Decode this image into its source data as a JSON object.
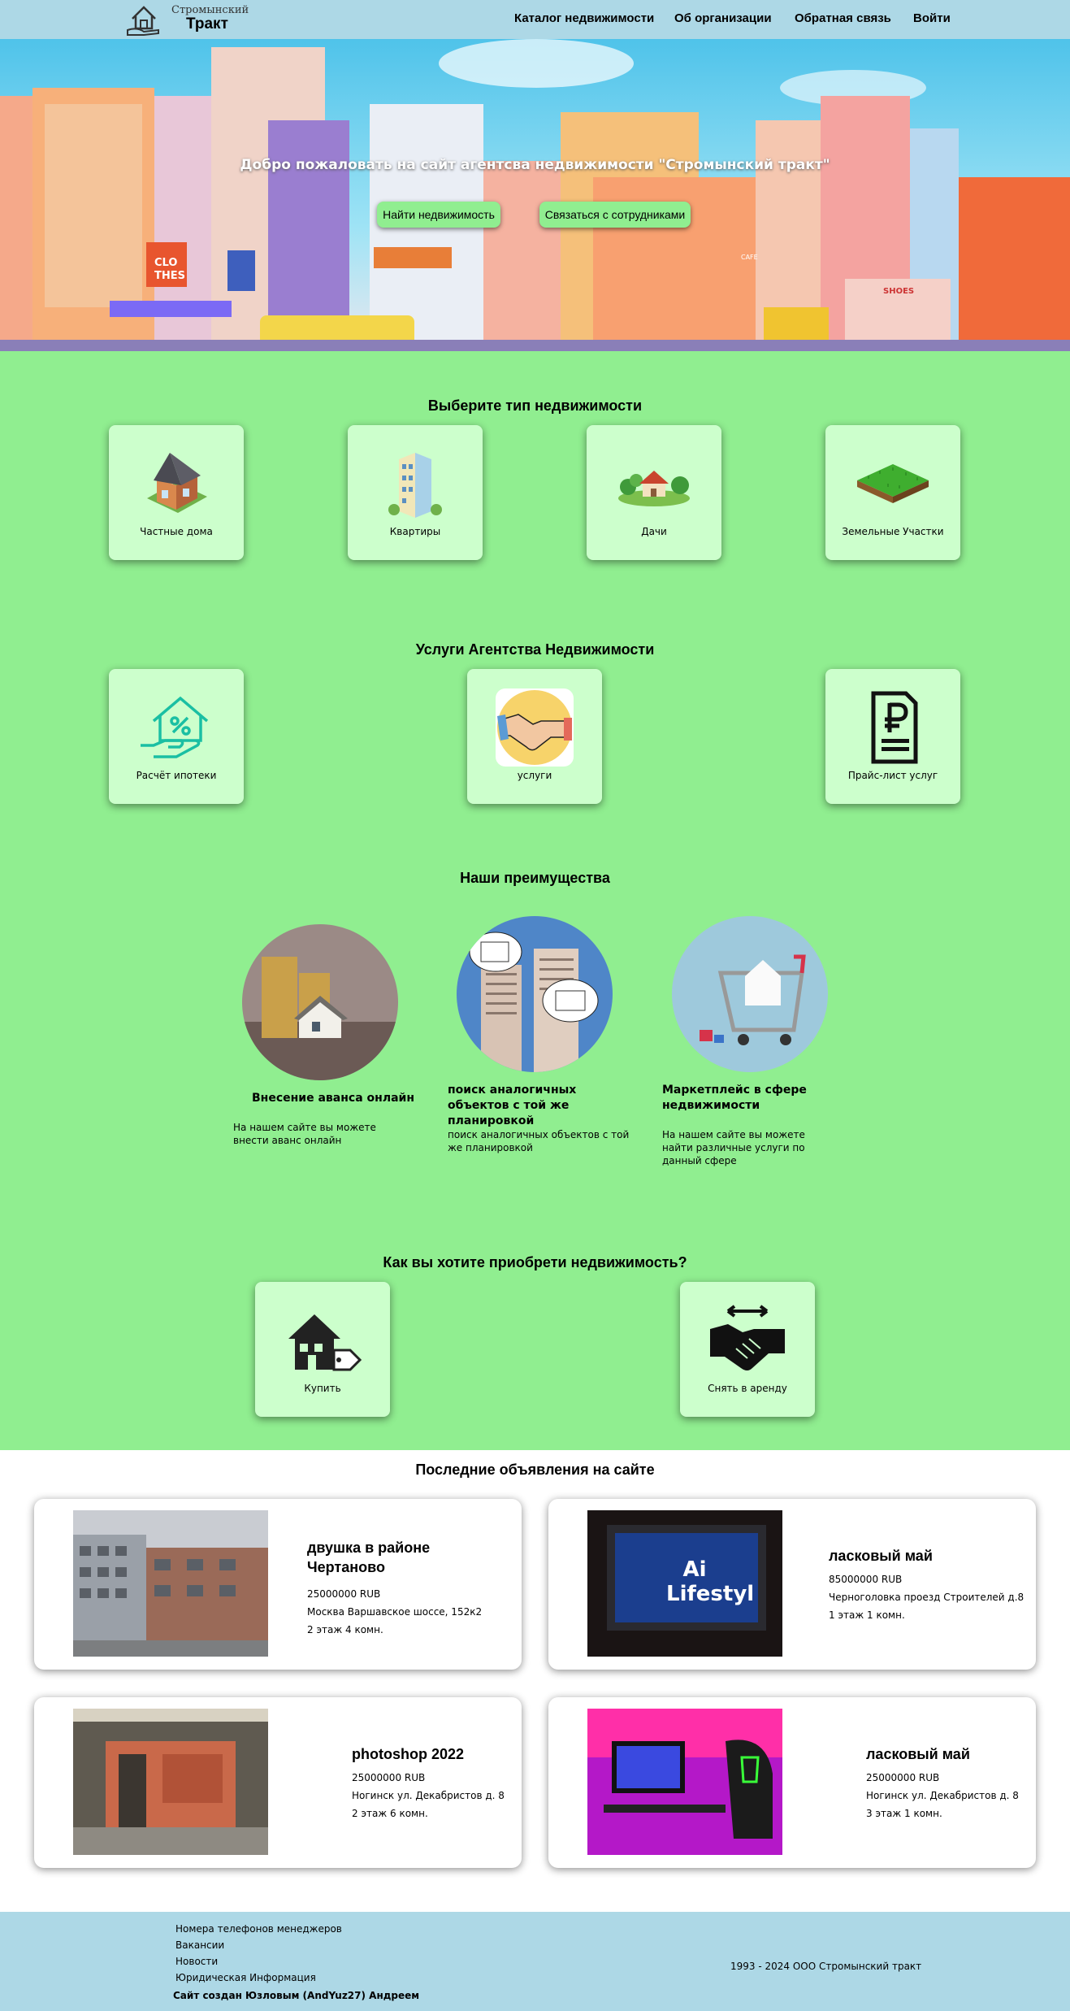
{
  "header": {
    "logo_line1": "Стромынский",
    "logo_line2": "Тракт",
    "nav": [
      "Каталог недвижимости",
      "Об организации",
      "Обратная связь",
      "Войти"
    ]
  },
  "hero": {
    "title": "Добро пожаловать на сайт агентсва недвижимости \"Стромынский тракт\"",
    "btn_find": "Найти недвижимость",
    "btn_contact": "Связаться с сотрудниками",
    "signs": [
      "CLO THES",
      "SHOES",
      "CAFE"
    ]
  },
  "types": {
    "title": "Выберите тип недвижимости",
    "items": [
      {
        "label": "Частные дома",
        "icon": "house-icon"
      },
      {
        "label": "Квартиры",
        "icon": "apartment-building-icon"
      },
      {
        "label": "Дачи",
        "icon": "country-house-icon"
      },
      {
        "label": "Земельные Участки",
        "icon": "land-plot-icon"
      }
    ]
  },
  "services": {
    "title": "Услуги Агентства Недвижимости",
    "items": [
      {
        "label": "Расчёт ипотеки",
        "icon": "mortgage-icon"
      },
      {
        "label": "услуги",
        "icon": "handshake-icon"
      },
      {
        "label": "Прайс-лист услуг",
        "icon": "price-list-icon"
      }
    ]
  },
  "advantages": {
    "title": "Наши преимущества",
    "items": [
      {
        "heading": "Внесение аванса онлайн",
        "text": "На нашем сайте вы можете внести аванс онлайн"
      },
      {
        "heading": "поиск аналогичных объектов с той же планировкой",
        "text": "поиск аналогичных объектов с той же планировкой"
      },
      {
        "heading": "Маркетплейс в сфере недвижимости",
        "text": "На нашем сайте вы можете найти различные услуги по данный сфере"
      }
    ]
  },
  "acquire": {
    "title": "Как вы хотите приобрети недвижимость?",
    "items": [
      {
        "label": "Купить",
        "icon": "house-price-tag-icon"
      },
      {
        "label": "Снять в аренду",
        "icon": "handshake-arrows-icon"
      }
    ]
  },
  "latest": {
    "title": "Последние объявления на сайте",
    "listings": [
      {
        "title": "двушка в районе Чертаново",
        "price": "25000000 RUB",
        "address": "Москва Варшавское шоссе, 152к2",
        "details": "2 этаж 4 комн."
      },
      {
        "title": "ласковый май",
        "price": "85000000 RUB",
        "address": "Черноголовка проезд Строителей д.8",
        "details": "1 этаж 1 комн.",
        "photo_text": "Ai Lifestyl"
      },
      {
        "title": "photoshop 2022",
        "price": "25000000 RUB",
        "address": "Ногинск ул. Декабристов д. 8",
        "details": "2 этаж 6 комн."
      },
      {
        "title": "ласковый май",
        "price": "25000000 RUB",
        "address": "Ногинск ул. Декабристов д. 8",
        "details": "3 этаж 1 комн."
      }
    ]
  },
  "footer": {
    "links": [
      "Номера телефонов менеджеров",
      "Вакансии",
      "Новости",
      "Юридическая Информация"
    ],
    "author": "Сайт создан Юзловым (AndYuz27) Андреем",
    "copyright": "1993 - 2024 ООО Стромынский тракт"
  }
}
